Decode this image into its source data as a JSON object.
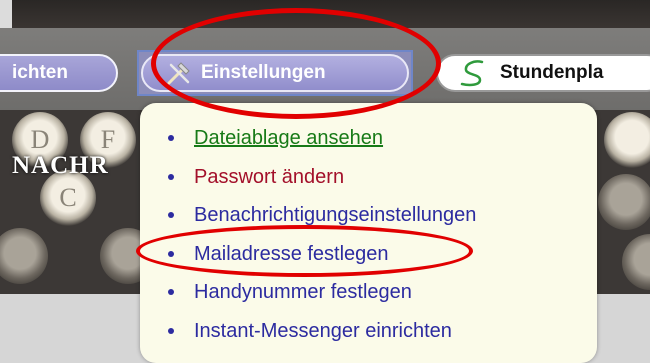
{
  "nav": {
    "tabs": [
      {
        "label": "ichten"
      },
      {
        "label": "Einstellungen"
      },
      {
        "label": "Stundenpla"
      }
    ]
  },
  "banner": {
    "title": "NACHR",
    "keys": [
      "D",
      "F",
      "C",
      "",
      "",
      ""
    ]
  },
  "menu": {
    "items": [
      {
        "label": "Dateiablage ansehen",
        "color": "#177a17",
        "underline": true
      },
      {
        "label": "Passwort ändern",
        "color": "#a3102a",
        "underline": false
      },
      {
        "label": "Benachrichtigungseinstellungen",
        "color": "#2c2ba0",
        "underline": false
      },
      {
        "label": "Mailadresse festlegen",
        "color": "#2c2ba0",
        "underline": false
      },
      {
        "label": "Handynummer festlegen",
        "color": "#2c2ba0",
        "underline": false
      },
      {
        "label": "Instant-Messenger einrichten",
        "color": "#2c2ba0",
        "underline": false
      }
    ]
  },
  "colors": {
    "annotation": "#e10000",
    "tab_purple": "#9e9bd5",
    "menu_background": "#fbfbe9"
  },
  "icons": {
    "settings": "tools-icon",
    "schedule": "hook-icon"
  }
}
